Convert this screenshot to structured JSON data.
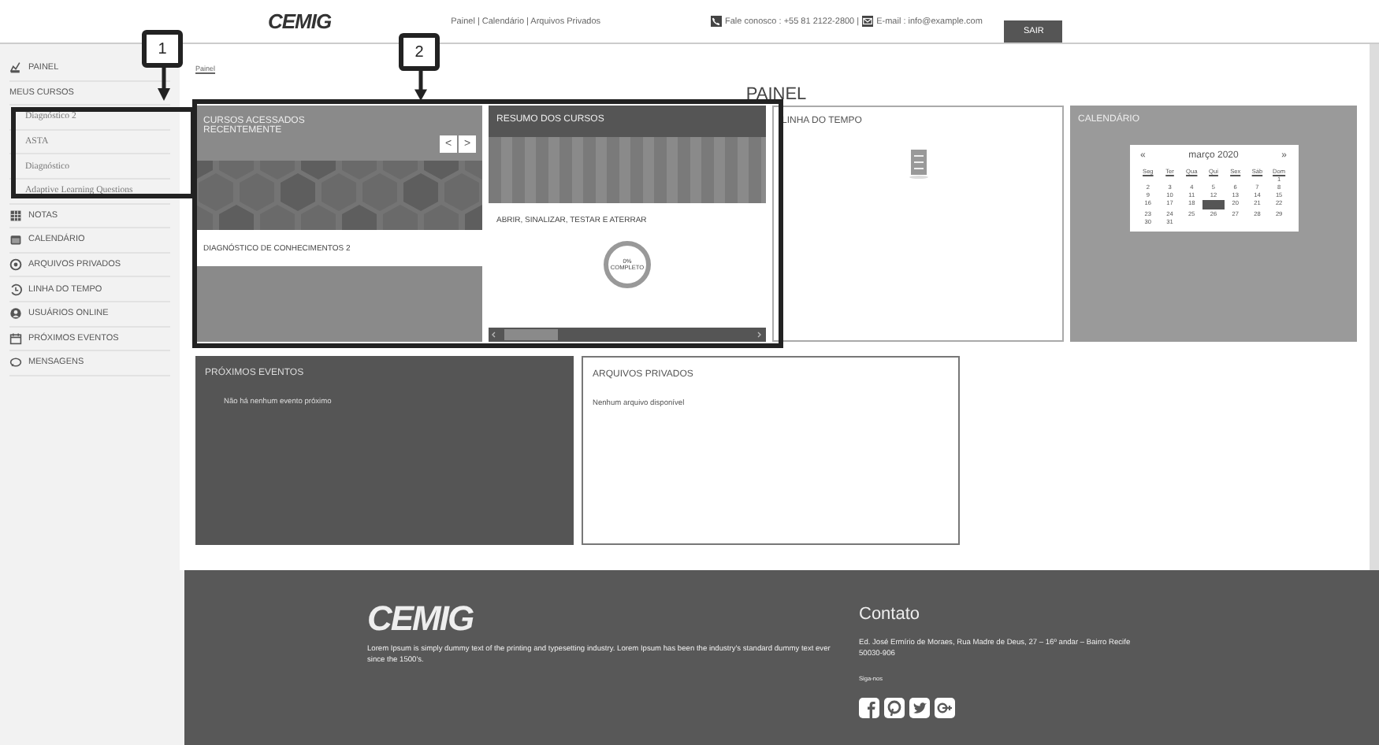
{
  "header": {
    "logo": "CEMIG",
    "nav": "Painel | Calendário | Arquivos Privados",
    "phone": "Fale conosco : +55 81 2122-2800 |",
    "email": "E-mail : info@example.com",
    "logout": "SAIR"
  },
  "sidebar": {
    "items": [
      {
        "label": "PAINEL"
      },
      {
        "label": "MEUS CURSOS",
        "children": [
          {
            "label": "Diagnóstico 2"
          },
          {
            "label": "ASTA"
          },
          {
            "label": "Diagnóstico"
          },
          {
            "label": "Adaptive Learning Questions"
          }
        ]
      },
      {
        "label": "NOTAS"
      },
      {
        "label": "CALENDÁRIO"
      },
      {
        "label": "ARQUIVOS PRIVADOS"
      },
      {
        "label": "LINHA DO TEMPO"
      },
      {
        "label": "USUÁRIOS ONLINE"
      },
      {
        "label": "PRÓXIMOS EVENTOS"
      },
      {
        "label": "MENSAGENS"
      }
    ]
  },
  "breadcrumb": "Painel",
  "page_title": "PAINEL",
  "recent_courses": {
    "title": "CURSOS ACESSADOS RECENTEMENTE",
    "prev": "<",
    "next": ">",
    "course": "DIAGNÓSTICO DE CONHECIMENTOS 2"
  },
  "course_summary": {
    "title": "RESUMO DOS CURSOS",
    "course": "ABRIR, SINALIZAR, TESTAR E ATERRAR",
    "percent": "0%",
    "percent_label": "COMPLETO"
  },
  "timeline": {
    "title": "LINHA DO TEMPO"
  },
  "calendar": {
    "title": "CALENDÁRIO",
    "prev": "«",
    "month": "março 2020",
    "next": "»",
    "weekdays": [
      "Seg",
      "Ter",
      "Qua",
      "Qui",
      "Sex",
      "Sáb",
      "Dom"
    ],
    "weeks": [
      [
        {
          "kind": "blank"
        },
        {
          "kind": "blank"
        },
        {
          "kind": "blank"
        },
        {
          "kind": "blank"
        },
        {
          "kind": "blank"
        },
        {
          "kind": "blank"
        },
        {
          "kind": "day",
          "day": "1"
        }
      ],
      [
        {
          "day": "2"
        },
        {
          "day": "3"
        },
        {
          "day": "4"
        },
        {
          "day": "5"
        },
        {
          "day": "6"
        },
        {
          "day": "7"
        },
        {
          "day": "8"
        }
      ],
      [
        {
          "day": "9"
        },
        {
          "day": "10"
        },
        {
          "day": "11"
        },
        {
          "day": "12"
        },
        {
          "day": "13"
        },
        {
          "day": "14"
        },
        {
          "day": "15"
        }
      ],
      [
        {
          "day": "16"
        },
        {
          "day": "17"
        },
        {
          "day": "18"
        },
        {
          "selected": true
        },
        {
          "day": "20"
        },
        {
          "day": "21"
        },
        {
          "day": "22"
        }
      ],
      [
        {
          "day": "23"
        },
        {
          "day": "24"
        },
        {
          "day": "25"
        },
        {
          "day": "26"
        },
        {
          "day": "27"
        },
        {
          "day": "28"
        },
        {
          "day": "29"
        }
      ],
      [
        {
          "day": "30"
        },
        {
          "day": "31"
        }
      ]
    ]
  },
  "upcoming_events": {
    "title": "PRÓXIMOS EVENTOS",
    "message": "Não há nenhum evento próximo"
  },
  "private_files": {
    "title": "ARQUIVOS PRIVADOS",
    "message": "Nenhum arquivo disponível"
  },
  "footer": {
    "logo": "CEMIG",
    "text": "Lorem Ipsum is simply dummy text of the printing and typesetting industry. Lorem Ipsum has been the industry's standard dummy text ever since the 1500's.",
    "contact_title": "Contato",
    "address": "Ed. José Ermírio de Moraes, Rua Madre de Deus, 27 – 16º andar – Bairro Recife",
    "zip": "50030-906",
    "follow": "Siga-nos"
  },
  "callouts": [
    {
      "number": "1"
    },
    {
      "number": "2"
    }
  ]
}
